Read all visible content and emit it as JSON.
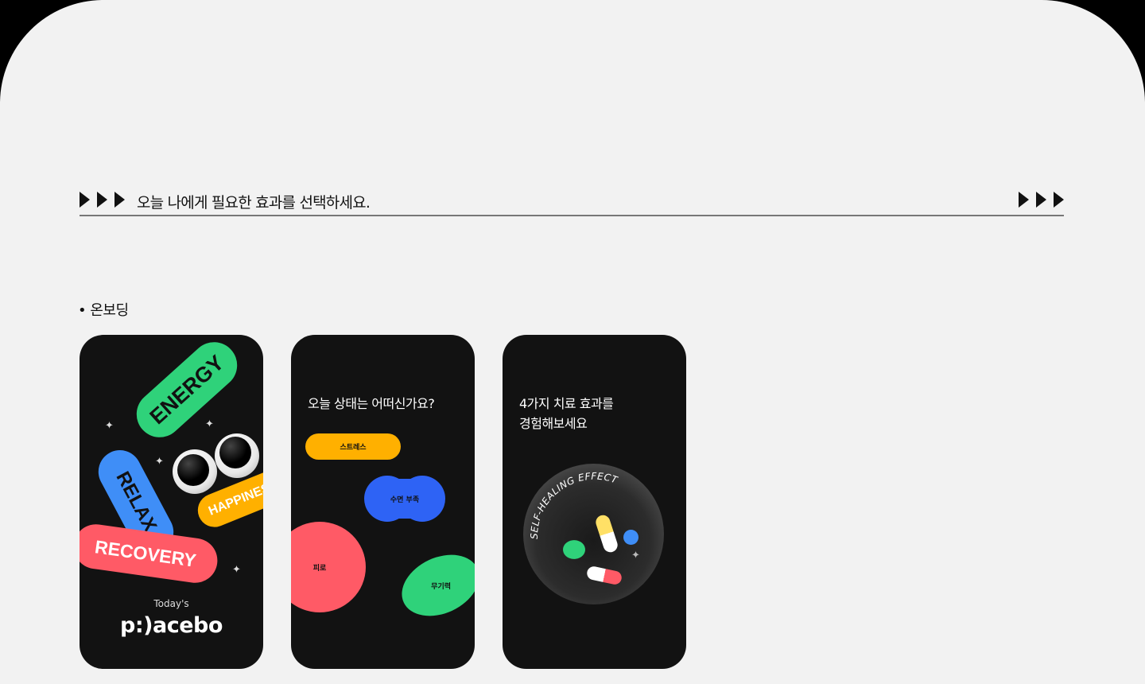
{
  "section": {
    "title": "오늘 나에게 필요한 효과를 선택하세요."
  },
  "subsection": {
    "label": "•  온보딩"
  },
  "screen1": {
    "pills": {
      "energy": "ENERGY",
      "relax": "RELAX",
      "happiness": "HAPPINESS",
      "recovery": "RECOVERY"
    },
    "tagline": "Today's",
    "logo": "p:)acebo"
  },
  "screen2": {
    "question": "오늘 상태는 어떠신가요?",
    "options": {
      "stress": "스트레스",
      "sleep": "수면 부족",
      "fatigue": "피로",
      "lethargy": "무기력"
    }
  },
  "screen3": {
    "line1": "4가지 치료 효과를",
    "line2": "경험해보세요",
    "orb_label": "SELF-HEALING EFFECT"
  },
  "colors": {
    "green": "#2fd27a",
    "blue": "#3f8ef7",
    "orange": "#ffb000",
    "pink": "#ff5a66",
    "royal": "#2e63f5",
    "bg": "#121212"
  }
}
